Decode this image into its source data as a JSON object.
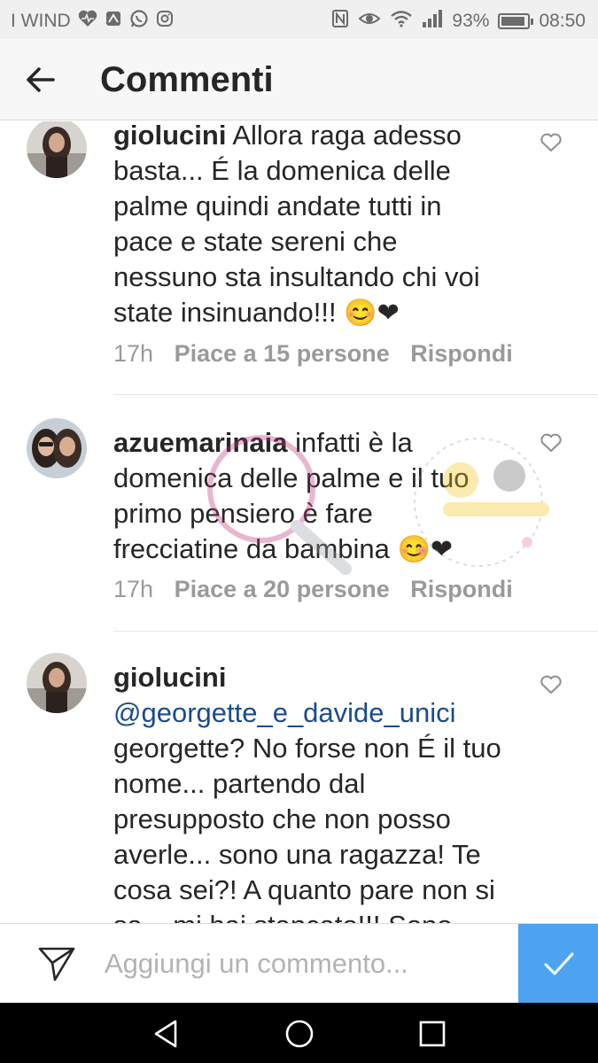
{
  "status_bar": {
    "carrier": "I WIND",
    "battery": "93%",
    "battery_level": 0.93,
    "time": "08:50"
  },
  "header": {
    "title": "Commenti"
  },
  "comments": [
    {
      "username": "giolucini",
      "text": "Allora raga adesso basta... É la domenica delle palme quindi andate tutti in pace e state sereni che nessuno sta insultando chi voi state insinuando!!!",
      "emojis": "😊❤",
      "time": "17h",
      "likes": "Piace a 15 persone",
      "reply": "Rispondi"
    },
    {
      "username": "azuemarinaia",
      "text": "infatti è la domenica delle palme e il tuo primo pensiero è fare frecciatine da bambina",
      "emojis": "😊❤",
      "time": "17h",
      "likes": "Piace a 20 persone",
      "reply": "Rispondi"
    },
    {
      "username": "giolucini",
      "mention": "@georgette_e_davide_unici",
      "text": "georgette? No forse non É il tuo nome... partendo dal presupposto che non posso averle... sono una ragazza! Te cosa sei?! A quanto pare non si sa... mi hai stancato!!! Sono stufa di"
    }
  ],
  "composer": {
    "placeholder": "Aggiungi un commento..."
  },
  "colors": {
    "accent": "#4ca3f0",
    "mention": "#1a4c8a",
    "meta": "#9a9a9a"
  }
}
